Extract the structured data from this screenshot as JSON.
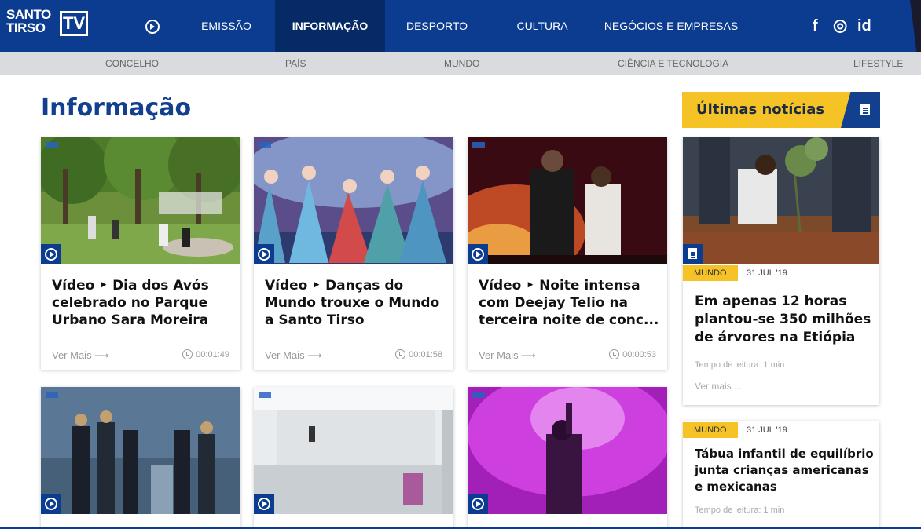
{
  "brand": {
    "line1": "SANTO",
    "line2": "TIRSO",
    "tv": "TV"
  },
  "nav": {
    "items": [
      {
        "label": "EMISSÃO"
      },
      {
        "label": "INFORMAÇÃO",
        "active": true
      },
      {
        "label": "DESPORTO"
      },
      {
        "label": "CULTURA"
      },
      {
        "label": "NEGÓCIOS E EMPRESAS"
      }
    ],
    "icons": [
      "play-circle-icon",
      "facebook-icon",
      "instagram-icon",
      "id-icon"
    ],
    "social": {
      "facebook": "f",
      "instagram": "◎",
      "id": "id"
    }
  },
  "subnav": {
    "items": [
      {
        "label": "CONCELHO"
      },
      {
        "label": "PAÍS"
      },
      {
        "label": "MUNDO"
      },
      {
        "label": "CIÊNCIA E TECNOLOGIA"
      },
      {
        "label": "LIFESTYLE"
      }
    ]
  },
  "page": {
    "title": "Informação"
  },
  "cards": [
    {
      "title": "Vídeo ‣ Dia dos Avós celebrado no Parque Urbano Sara Moreira",
      "more": "Ver Mais ⟶",
      "duration": "00:01:49"
    },
    {
      "title": "Vídeo ‣ Danças do Mundo trouxe o Mundo a Santo Tirso",
      "more": "Ver Mais ⟶",
      "duration": "00:01:58"
    },
    {
      "title": "Vídeo ‣ Noite intensa com Deejay Telio na terceira noite de conc...",
      "more": "Ver Mais ⟶",
      "duration": "00:00:53"
    },
    {
      "title": ""
    },
    {
      "title": ""
    },
    {
      "title": ""
    }
  ],
  "sidebar": {
    "heading": "Últimas notícias",
    "news": [
      {
        "tag": "MUNDO",
        "date": "31 JUL '19",
        "title": "Em apenas 12 horas plantou-se 350 milhões de árvores na Etiópia",
        "read_time": "Tempo de leitura: 1 min",
        "more": "Ver mais ..."
      },
      {
        "tag": "MUNDO",
        "date": "31 JUL '19",
        "title": "Tábua infantil de equilíbrio junta crianças americanas e mexicanas",
        "read_time": "Tempo de leitura: 1 min"
      }
    ]
  },
  "colors": {
    "primary": "#0b3c8f",
    "active_nav": "#062a66",
    "accent": "#f5c326",
    "subnav_bg": "#d9dbde"
  }
}
